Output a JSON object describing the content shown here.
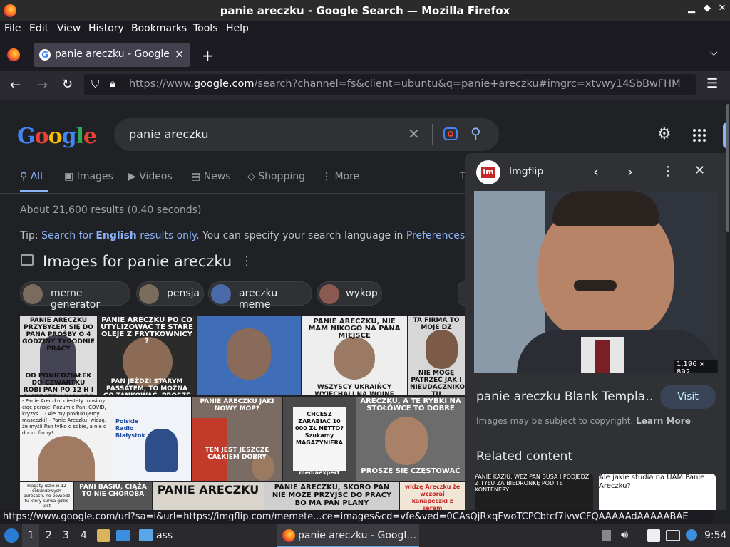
{
  "window": {
    "title": "panie areczku - Google Search — Mozilla Firefox"
  },
  "menu": [
    "File",
    "Edit",
    "View",
    "History",
    "Bookmarks",
    "Tools",
    "Help"
  ],
  "tab": {
    "label": "panie areczku - Google S",
    "close": "×",
    "new": "+"
  },
  "url": {
    "prefix": "https://www.",
    "domain": "google.com",
    "path": "/search?channel=fs&client=ubuntu&q=panie+areczku#imgrc=xtvwy14SbBwFHM"
  },
  "search": {
    "query": "panie areczku"
  },
  "tabs": [
    {
      "label": "All",
      "icon": "search-icon"
    },
    {
      "label": "Images",
      "icon": "image-icon"
    },
    {
      "label": "Videos",
      "icon": "play-icon"
    },
    {
      "label": "News",
      "icon": "news-icon"
    },
    {
      "label": "Shopping",
      "icon": "tag-icon"
    },
    {
      "label": "More",
      "icon": "kebab-icon"
    },
    {
      "label": "T",
      "icon": ""
    }
  ],
  "results": {
    "stats": "About 21,600 results (0.40 seconds)",
    "tip_prefix": "Tip: ",
    "tip_link1": "Search for ",
    "tip_link1_bold": "English",
    "tip_link1_rest": " results only",
    "tip_mid": ". You can specify your search language in ",
    "tip_link2": "Preferences"
  },
  "images_section": {
    "title": "Images for panie areczku"
  },
  "chips": [
    "meme generator",
    "pensja",
    "areczku meme",
    "wykop"
  ],
  "tiles": [
    {
      "caption_top": "PANIE ARECZKU PRZYBYŁEM SIĘ DO PANA PROŚBY O 4 GODZINY TYGODNIE PRACY",
      "caption_bottom": "OD PONIEDZIAŁEK DO CZWARTKU ROBI PAN PO 12 H I PIĄTECZEK WOLNY!"
    },
    {
      "caption_top": "PANIE ARECZKU PO CO UTYLIZOWAĆ TE STARE OLEJE Z FRYTKOWNICY ?",
      "caption_bottom": "PAN JEŹDZI STARYM PASSATEM, TO MOŻNA GO TANKOWAĆ. PROSZĘ TO TANKOWAĆ"
    },
    {
      "caption_top": "",
      "caption_bottom": ""
    },
    {
      "caption_top": "PANIE ARECZKU, NIE MAM NIKOGO NA PANA MIEJSCE",
      "caption_bottom": "WSZYSCY UKRAIŃCY WYJECHALI NA WOJNĘ"
    },
    {
      "caption_top": "TA FIRMA TO MOJE DZ",
      "caption_bottom": "NIE MOGĘ PATRZEĆ JAK I NIEUDACZNIKOW TU"
    },
    {
      "caption_top": "- Panie Areczku, niestety musimy ciąć pensje. Rozumie Pan: COVID, kryzys... - Ale my produkujemy maseczki! - Panie Areczku, widzę, że myśli Pan tylko o sobie, a nie o dobru firmy!",
      "caption_bottom": ""
    },
    {
      "caption_top": "Polskie Radio Białystok",
      "caption_bottom": ""
    },
    {
      "caption_top": "PANIE ARECZKU JAKI NOWY MOP?",
      "caption_bottom": "TEN JEST JESZCZE CAŁKIEM DOBRY"
    },
    {
      "caption_top": "CHCESZ ZARABIAĆ 10 000 ZŁ NETTO? Szukamy MAGAZYNIERA",
      "caption_bottom": "mediaexpert"
    },
    {
      "caption_top": "ARECZKU, A TE RYBKI NA STOŁÓWCE TO DOBRE",
      "caption_bottom": "PROSZĘ SIĘ CZĘSTOWAĆ"
    },
    {
      "caption_top": "Fragaty idzie w 12 sekundowych perosach, no powiedz tu który kurwa gdzie jest",
      "caption_bottom": ""
    },
    {
      "caption_top": "PANI BASIU, CIĄŻA TO NIE CHOROBA",
      "caption_bottom": ""
    },
    {
      "caption_top": "PANIE ARECZKU",
      "caption_bottom": ""
    },
    {
      "caption_top": "PANIE ARECZKU, SKORO PAN NIE MOŻE PRZYJŚĆ DO PRACY BO MA PAN PLANY",
      "caption_bottom": ""
    },
    {
      "caption_top": "widzę Areczku że wczoraj kanapeczki z serem",
      "caption_bottom": ""
    }
  ],
  "panel": {
    "source": "Imgflip",
    "dimensions": "1,196 × 892",
    "title": "panie areczku Blank Templa…",
    "visit": "Visit",
    "copyright": "Images may be subject to copyright.",
    "learn_more": "Learn More",
    "related": "Related content",
    "related_captions": [
      "PANIE KAZIU, WEŹ PAN BUSA I PODJEDŹ Z TYŁU ZA BIEDRONKĘ POD TE KONTENERY",
      "Ale jakie studia na UAM Panie Areczku?"
    ]
  },
  "status_url": "https://www.google.com/url?sa=i&url=https://imgflip.com/memete...ce=images&cd=vfe&ved=0CAsQjRxqFwoTCPCbtcf7ivwCFQAAAAAdAAAAABAE",
  "taskbar": {
    "workspaces": [
      "1",
      "2",
      "3",
      "4"
    ],
    "folder_label": "ass",
    "window_label": "panie areczku - Googl…",
    "clock": "9:54"
  },
  "colors": {
    "link": "#8ab4f8",
    "accent": "#8ab4f8",
    "page_bg": "#202124",
    "panel_bg": "#303134"
  }
}
